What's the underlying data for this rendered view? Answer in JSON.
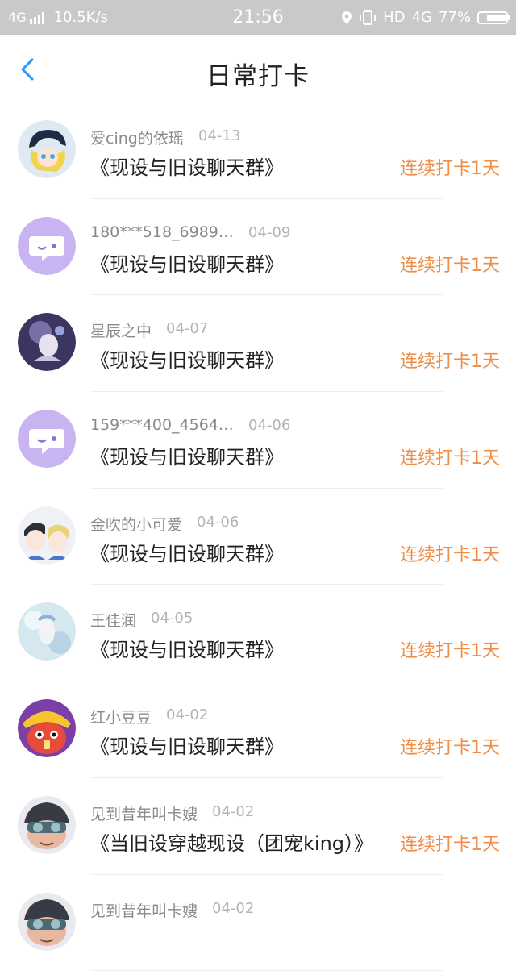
{
  "status_bar": {
    "network": "4G",
    "speed": "10.5K/s",
    "time": "21:56",
    "hd": "HD",
    "net_right": "4G",
    "battery": "77%",
    "battery_level": 0.77
  },
  "header": {
    "title": "日常打卡"
  },
  "streak_label": "连续打卡1天",
  "rows": [
    {
      "user": "爱cing的依瑶",
      "date": "04-13",
      "group": "《现设与旧设聊天群》",
      "avatar": "anime-boy-avatar"
    },
    {
      "user": "180***518_6989…",
      "date": "04-09",
      "group": "《现设与旧设聊天群》",
      "avatar": "default-chat-avatar"
    },
    {
      "user": "星辰之中",
      "date": "04-07",
      "group": "《现设与旧设聊天群》",
      "avatar": "dark-art-avatar"
    },
    {
      "user": "159***400_4564…",
      "date": "04-06",
      "group": "《现设与旧设聊天群》",
      "avatar": "default-chat-avatar"
    },
    {
      "user": "金吹的小可爱",
      "date": "04-06",
      "group": "《现设与旧设聊天群》",
      "avatar": "anime-duo-avatar"
    },
    {
      "user": "王佳润",
      "date": "04-05",
      "group": "《现设与旧设聊天群》",
      "avatar": "light-art-avatar"
    },
    {
      "user": "红小豆豆",
      "date": "04-02",
      "group": "《现设与旧设聊天群》",
      "avatar": "red-cartoon-avatar"
    },
    {
      "user": "见到昔年叫卡嫂",
      "date": "04-02",
      "group": "《当旧设穿越现设（团宠king）》",
      "avatar": "goggles-avatar"
    },
    {
      "user": "见到昔年叫卡嫂",
      "date": "04-02",
      "group": "",
      "avatar": "goggles-avatar"
    }
  ],
  "colors": {
    "accent": "#f08d47",
    "back_arrow": "#2b97f0",
    "default_avatar": "#c9b4f2"
  }
}
